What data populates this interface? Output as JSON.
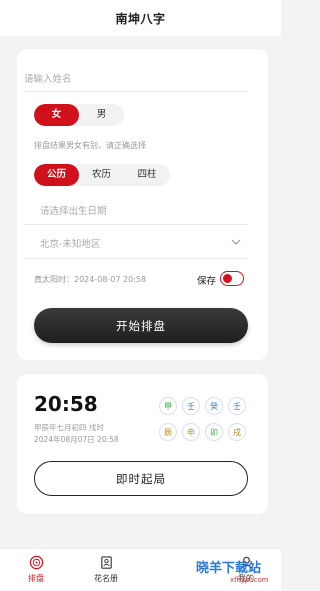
{
  "app": {
    "title": "南坤八字"
  },
  "form": {
    "name_placeholder": "请输入姓名",
    "gender": {
      "options": [
        "女",
        "男"
      ],
      "selected": "女"
    },
    "gender_hint": "排盘结果男女有别，请正确选择",
    "calendar": {
      "options": [
        "公历",
        "农历",
        "四柱"
      ],
      "selected": "公历"
    },
    "birth_placeholder": "请选择出生日期",
    "region": "北京-未知地区",
    "solar_time_label": "真太阳时：2024-08-07 20:58",
    "save_label": "保存",
    "save_on": true,
    "start_label": "开始排盘"
  },
  "now": {
    "time": "20:58",
    "lunar": "甲辰年七月初四 戌时",
    "solar": "2024年08月07日 20:58",
    "gan": [
      "甲",
      "壬",
      "癸",
      "壬"
    ],
    "zhi": [
      "辰",
      "申",
      "卯",
      "戌"
    ],
    "colors": {
      "wood": "#3aa64a",
      "water": "#2a79d8",
      "earth": "#b58a1b",
      "metal": "#c19a2a"
    },
    "button_label": "即时起局"
  },
  "tabs": [
    {
      "label": "排盘",
      "icon": "paipan-icon",
      "active": true
    },
    {
      "label": "花名册",
      "icon": "roster-icon",
      "active": false
    },
    {
      "label": "我的",
      "icon": "profile-icon",
      "active": false
    }
  ],
  "watermark": {
    "text": "晓羊下载站",
    "url": "xfhyjx.com"
  },
  "colors": {
    "accent": "#d0111b",
    "dark_button": "#2a2a2a"
  }
}
